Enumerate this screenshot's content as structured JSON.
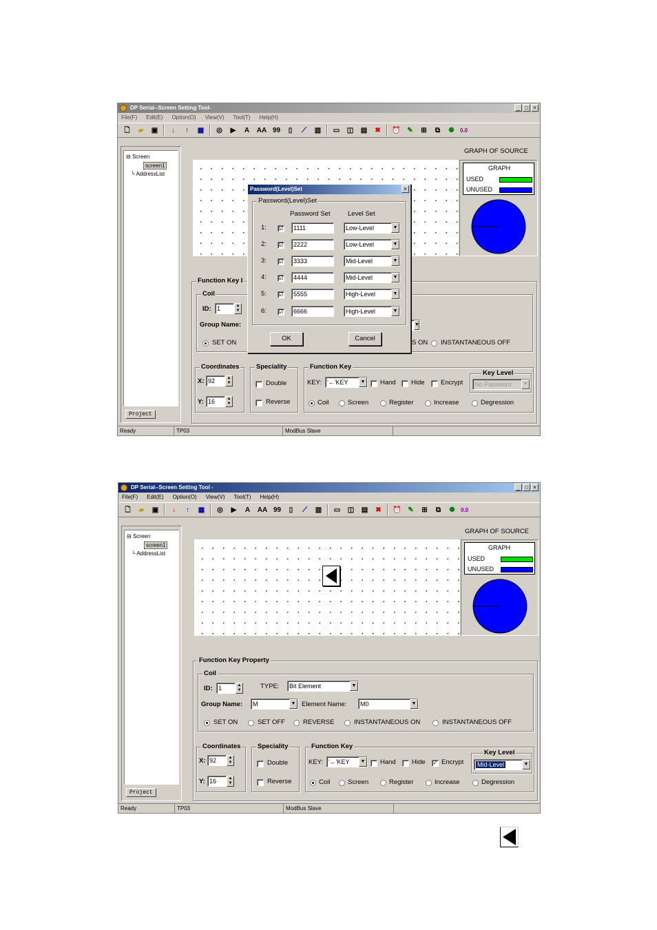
{
  "top": {
    "title": "DP Serial--Screen Setting Tool-",
    "menu": [
      "File(F)",
      "Edit(E)",
      "Option(O)",
      "View(V)",
      "Tool(T)",
      "Help(H)"
    ],
    "toolbar_text": {
      "a": "A",
      "aa": "AA",
      "nn": "99",
      "zoom": "0.0"
    },
    "tree": {
      "root": "Screen",
      "child": "screen1",
      "list": "AddressList"
    },
    "project_tab": "Project",
    "graph": {
      "heading": "GRAPH OF SOURCE",
      "legend_title": "GRAPH",
      "used": "USED",
      "unused": "UNUSED",
      "used_color": "#00e000",
      "unused_color": "#0000ff"
    },
    "dialog": {
      "title": "Password(Level)Set",
      "group": "Password(Level)Set",
      "col_password": "Password Set",
      "col_level": "Level Set",
      "rows": [
        {
          "no": "1:",
          "checked": "☑",
          "password": "1111",
          "level": "Low-Level"
        },
        {
          "no": "2:",
          "checked": "☑",
          "password": "2222",
          "level": "Low-Level"
        },
        {
          "no": "3:",
          "checked": "☑",
          "password": "3333",
          "level": "Mid-Level"
        },
        {
          "no": "4:",
          "checked": "☑",
          "password": "4444",
          "level": "Mid-Level"
        },
        {
          "no": "5:",
          "checked": "☑",
          "password": "5555",
          "level": "High-Level"
        },
        {
          "no": "6:",
          "checked": "☑",
          "password": "6666",
          "level": "High-Level"
        }
      ],
      "ok": "OK",
      "cancel": "Cancel"
    },
    "prop": {
      "group_partial": "Function Key I",
      "coil": "Coil",
      "id_label": "ID:",
      "id_value": "1",
      "group_name": "Group Name:",
      "set_on": "SET ON",
      "s_on_partial": "S ON",
      "inst_off": "INSTANTANEOUS OFF"
    },
    "coords": {
      "title": "Coordinates",
      "x_label": "X:",
      "x": "92",
      "y_label": "Y:",
      "y": "16"
    },
    "spec": {
      "title": "Speciality",
      "double": "Double",
      "reverse": "Reverse"
    },
    "fkey": {
      "title": "Function Key",
      "key_label": "KEY:",
      "key": "'←'KEY",
      "hand": "Hand",
      "hide": "Hide",
      "encrypt": "Encrypt",
      "level_title": "Key Level",
      "level": "No Password",
      "coil": "Coil",
      "screen": "Screen",
      "register": "Register",
      "increase": "Increase",
      "degression": "Degression"
    },
    "status": [
      "Ready",
      "TP03",
      "ModBus Slave"
    ]
  },
  "bottom": {
    "title": "DP Serial--Screen Setting Tool -",
    "menu": [
      "File(F)",
      "Edit(E)",
      "Option(O)",
      "View(V)",
      "Tool(T)",
      "Help(H)"
    ],
    "toolbar_text": {
      "a": "A",
      "aa": "AA",
      "nn": "99",
      "zoom": "0.0"
    },
    "tree": {
      "root": "Screen",
      "child": "screen1",
      "list": "AddressList"
    },
    "project_tab": "Project",
    "graph": {
      "heading": "GRAPH OF SOURCE",
      "legend_title": "GRAPH",
      "used": "USED",
      "unused": "UNUSED"
    },
    "prop": {
      "title": "Function Key Property",
      "coil": "Coil",
      "id_label": "ID:",
      "id_value": "1",
      "type_label": "TYPE:",
      "type_value": "Bit Element",
      "group_name": "Group Name:",
      "group_value": "M",
      "element_name": "Element Name:",
      "element_value": "M0",
      "set_on": "SET ON",
      "set_off": "SET OFF",
      "reverse": "REVERSE",
      "inst_on": "INSTANTANEOUS ON",
      "inst_off": "INSTANTANEOUS OFF"
    },
    "coords": {
      "title": "Coordinates",
      "x_label": "X:",
      "x": "92",
      "y_label": "Y:",
      "y": "16"
    },
    "spec": {
      "title": "Speciality",
      "double": "Double",
      "reverse": "Reverse"
    },
    "fkey": {
      "title": "Function Key",
      "key_label": "KEY:",
      "key": "'←'KEY",
      "hand": "Hand",
      "hide": "Hide",
      "encrypt": "Encrypt",
      "level_title": "Key Level",
      "level": "Mid-Level",
      "coil": "Coil",
      "screen": "Screen",
      "register": "Register",
      "increase": "Increase",
      "degression": "Degression"
    },
    "status": [
      "Ready",
      "TP03",
      "ModBus Slave"
    ]
  }
}
